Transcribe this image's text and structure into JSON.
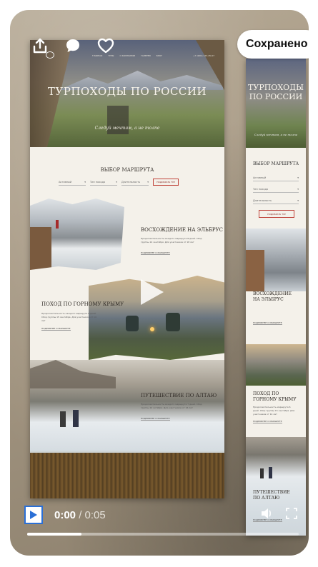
{
  "saved_label": "Сохранено!",
  "main_mockup": {
    "hero_title": "ТУРПОХОДЫ ПО РОССИИ",
    "hero_subtitle": "Следуй мечтам, а не толпе",
    "nav_items": [
      "ГЛАВНАЯ",
      "ТУРЫ",
      "О КОМПАНИИ",
      "ГАЛЕРЕЯ",
      "БЛОГ"
    ],
    "nav_right": "+7 (900) 123-45-67",
    "section_title": "ВЫБОР МАРШРУТА",
    "filters": [
      "Активный",
      "Тип похода",
      "Длительность"
    ],
    "filter_button": "ПОДОБРАТЬ ТУР",
    "routes": [
      {
        "name": "ВОСХОЖДЕНИЕ НА ЭЛЬБРУС",
        "text": "Продолжительность каждого маршрута 8 дней. Сбор группы 14 сентября. Для участников от 18 лет",
        "link": "ПОДРОБНЕЕ О МАРШРУТЕ"
      },
      {
        "name": "ПОХОД ПО ГОРНОМУ КРЫМУ",
        "text": "Продолжительность каждого маршрута 6 дней. Сбор группы 15 сентября. Для участников от 14 лет",
        "link": "ПОДРОБНЕЕ О МАРШРУТЕ"
      },
      {
        "name": "ПУТЕШЕСТВИЕ ПО АЛТАЮ",
        "text": "Продолжительность каждого маршрута 7 дней. Сбор группы 12 октября. Для участников от 16 лет",
        "link": "ПОДРОБНЕЕ О МАРШРУТЕ"
      }
    ]
  },
  "side_mockup": {
    "hero_title": "ТУРПОХОДЫ ПО РОССИИ",
    "hero_subtitle": "Следуй мечтам, а не толпе",
    "section_title": "ВЫБОР МАРШРУТА",
    "filters": [
      "Активный",
      "Тип похода",
      "Длительность"
    ],
    "filter_button": "ПОДОБРАТЬ ТУР",
    "routes": [
      {
        "name": "ВОСХОЖДЕНИЕ НА ЭЛЬБРУС",
        "link": "ПОДРОБНЕЕ О МАРШРУТЕ"
      },
      {
        "name": "ПОХОД ПО ГОРНОМУ КРЫМУ",
        "text": "Продолжительность маршрута 6 дней. Сбор группы 15 сентября. Для участников от 14 лет",
        "link": "ПОДРОБНЕЕ О МАРШРУТЕ"
      },
      {
        "name": "ПУТЕШЕСТВИЕ ПО АЛТАЮ",
        "link": "ПОДРОБНЕЕ О МАРШРУТЕ"
      }
    ]
  },
  "player": {
    "current_time": "0:00",
    "separator": " / ",
    "duration": "0:05",
    "progress_fraction": 0.2
  },
  "colors": {
    "accent_button": "#c0443b",
    "play_border": "#2a6fd6"
  }
}
